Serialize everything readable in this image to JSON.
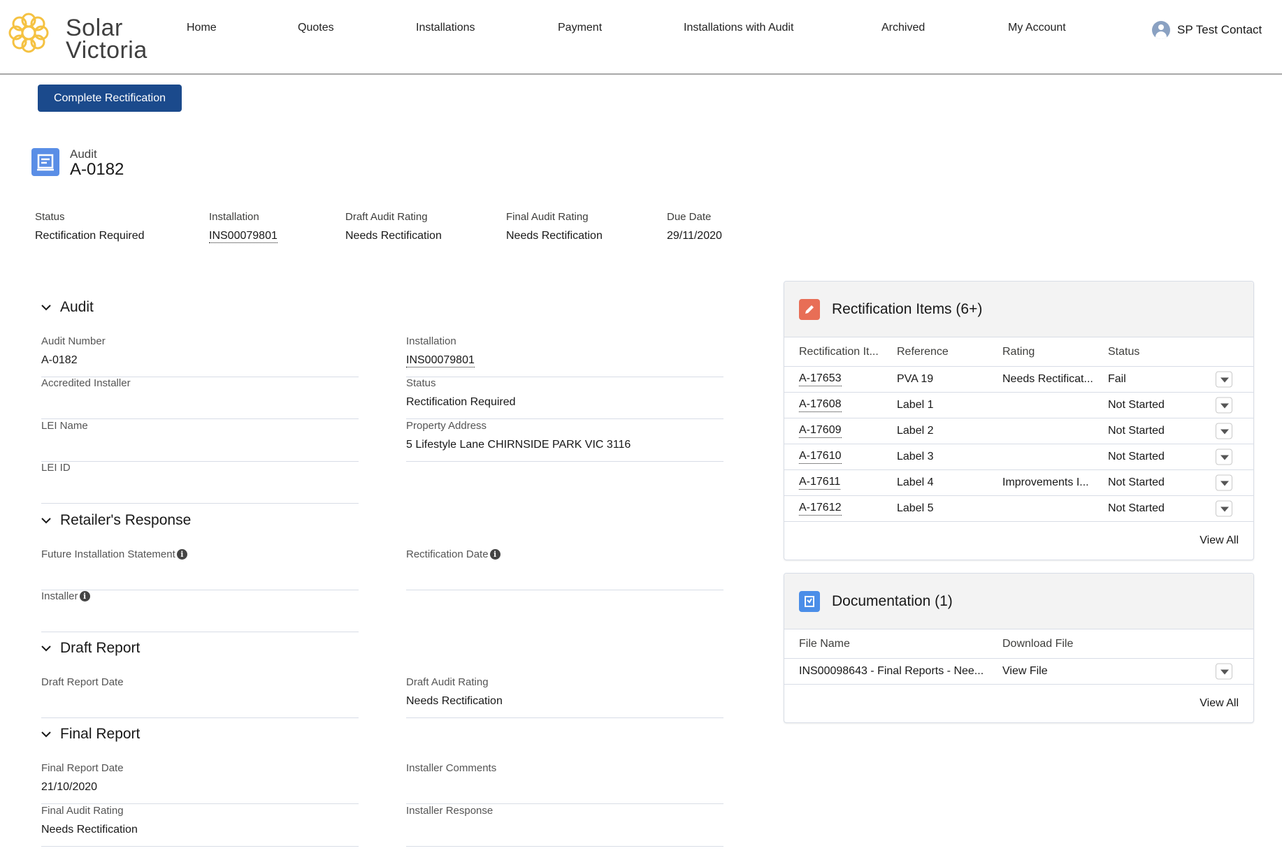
{
  "brand": {
    "line1": "Solar",
    "line2": "Victoria",
    "accent": "#f5c242"
  },
  "nav": {
    "items": [
      "Home",
      "Quotes",
      "Installations",
      "Payment",
      "Installations with Audit",
      "Archived",
      "My Account"
    ],
    "user": "SP Test Contact"
  },
  "actions": {
    "complete_label": "Complete Rectification"
  },
  "record": {
    "type": "Audit",
    "title": "A-0182",
    "highlights": [
      {
        "label": "Status",
        "value": "Rectification Required"
      },
      {
        "label": "Installation",
        "value": "INS00079801"
      },
      {
        "label": "Draft Audit Rating",
        "value": "Needs Rectification"
      },
      {
        "label": "Final Audit Rating",
        "value": "Needs Rectification"
      },
      {
        "label": "Due Date",
        "value": "29/11/2020"
      }
    ]
  },
  "sections": {
    "audit": {
      "title": "Audit",
      "audit_number": {
        "label": "Audit Number",
        "value": "A-0182"
      },
      "installation": {
        "label": "Installation",
        "value": "INS00079801"
      },
      "accredited_installer": {
        "label": "Accredited Installer",
        "value": ""
      },
      "status": {
        "label": "Status",
        "value": "Rectification Required"
      },
      "lei_name": {
        "label": "LEI Name",
        "value": ""
      },
      "property_address": {
        "label": "Property Address",
        "value": "5 Lifestyle Lane CHIRNSIDE PARK VIC 3116"
      },
      "lei_id": {
        "label": "LEI ID",
        "value": ""
      }
    },
    "retailer": {
      "title": "Retailer's Response",
      "future_statement": {
        "label": "Future Installation Statement"
      },
      "rectification_date": {
        "label": "Rectification Date"
      },
      "installer": {
        "label": "Installer"
      }
    },
    "draft": {
      "title": "Draft Report",
      "draft_report_date": {
        "label": "Draft Report Date",
        "value": ""
      },
      "draft_audit_rating": {
        "label": "Draft Audit Rating",
        "value": "Needs Rectification"
      }
    },
    "final": {
      "title": "Final Report",
      "final_report_date": {
        "label": "Final Report Date",
        "value": "21/10/2020"
      },
      "installer_comments": {
        "label": "Installer Comments",
        "value": ""
      },
      "final_audit_rating": {
        "label": "Final Audit Rating",
        "value": "Needs Rectification"
      },
      "installer_response": {
        "label": "Installer Response",
        "value": ""
      }
    }
  },
  "rectification": {
    "title": "Rectification Items (6+)",
    "icon_color": "#e86e56",
    "headers": [
      "Rectification It...",
      "Reference",
      "Rating",
      "Status"
    ],
    "rows": [
      {
        "id": "A-17653",
        "reference": "PVA 19",
        "rating": "Needs Rectificat...",
        "status": "Fail"
      },
      {
        "id": "A-17608",
        "reference": "Label 1",
        "rating": "",
        "status": "Not Started"
      },
      {
        "id": "A-17609",
        "reference": "Label 2",
        "rating": "",
        "status": "Not Started"
      },
      {
        "id": "A-17610",
        "reference": "Label 3",
        "rating": "",
        "status": "Not Started"
      },
      {
        "id": "A-17611",
        "reference": "Label 4",
        "rating": "Improvements I...",
        "status": "Not Started"
      },
      {
        "id": "A-17612",
        "reference": "Label 5",
        "rating": "",
        "status": "Not Started"
      }
    ],
    "view_all": "View All"
  },
  "documentation": {
    "title": "Documentation (1)",
    "icon_color": "#4b8ee8",
    "headers": [
      "File Name",
      "Download File"
    ],
    "rows": [
      {
        "file": "INS00098643 - Final Reports - Nee...",
        "download": "View File"
      }
    ],
    "view_all": "View All"
  }
}
